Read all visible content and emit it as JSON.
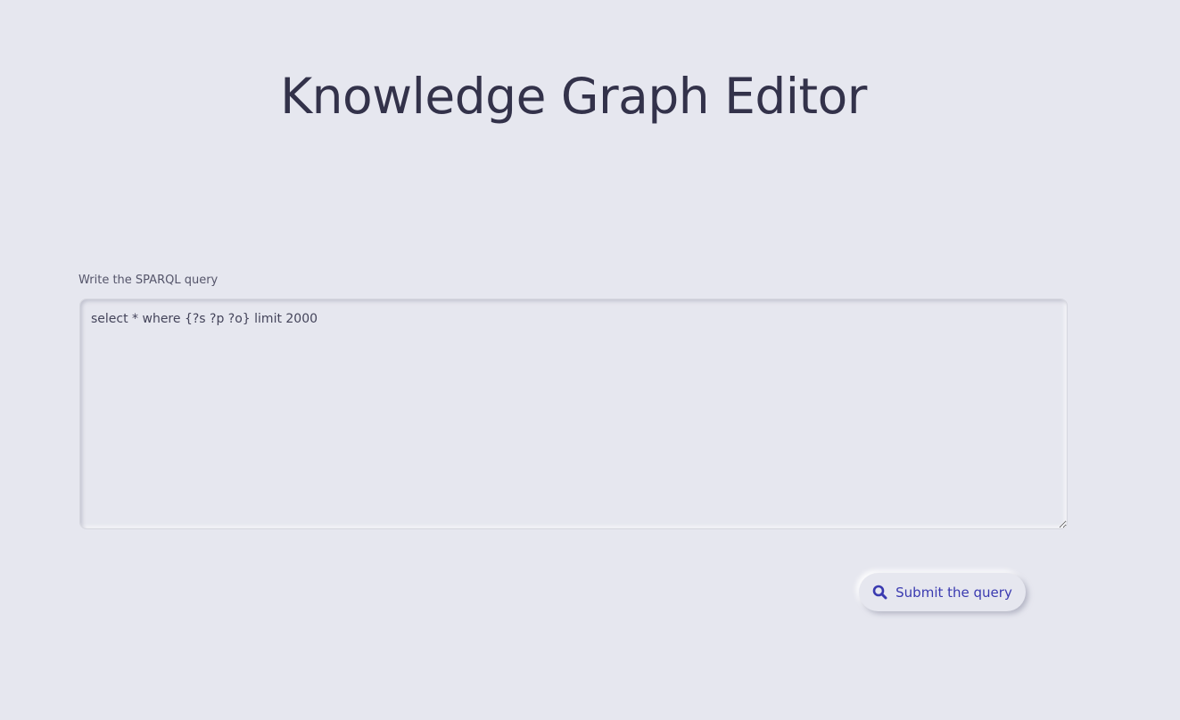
{
  "header": {
    "title": "Knowledge Graph Editor"
  },
  "query": {
    "label": "Write the SPARQL query",
    "value": "select * where {?s ?p ?o} limit 2000"
  },
  "actions": {
    "submit_label": "Submit the query",
    "submit_icon": "search-icon"
  },
  "colors": {
    "background": "#e6e7ef",
    "title": "#33324a",
    "accent": "#3a3ab0"
  }
}
